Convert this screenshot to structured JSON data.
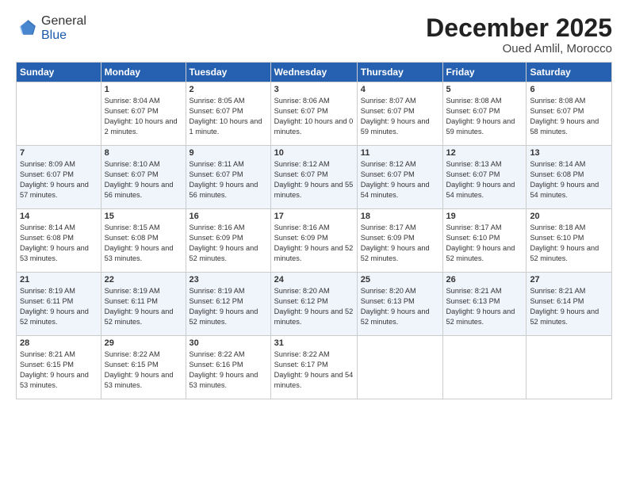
{
  "header": {
    "logo_general": "General",
    "logo_blue": "Blue",
    "month_title": "December 2025",
    "location": "Oued Amlil, Morocco"
  },
  "weekdays": [
    "Sunday",
    "Monday",
    "Tuesday",
    "Wednesday",
    "Thursday",
    "Friday",
    "Saturday"
  ],
  "weeks": [
    [
      {
        "day": "",
        "sunrise": "",
        "sunset": "",
        "daylight": ""
      },
      {
        "day": "1",
        "sunrise": "Sunrise: 8:04 AM",
        "sunset": "Sunset: 6:07 PM",
        "daylight": "Daylight: 10 hours and 2 minutes."
      },
      {
        "day": "2",
        "sunrise": "Sunrise: 8:05 AM",
        "sunset": "Sunset: 6:07 PM",
        "daylight": "Daylight: 10 hours and 1 minute."
      },
      {
        "day": "3",
        "sunrise": "Sunrise: 8:06 AM",
        "sunset": "Sunset: 6:07 PM",
        "daylight": "Daylight: 10 hours and 0 minutes."
      },
      {
        "day": "4",
        "sunrise": "Sunrise: 8:07 AM",
        "sunset": "Sunset: 6:07 PM",
        "daylight": "Daylight: 9 hours and 59 minutes."
      },
      {
        "day": "5",
        "sunrise": "Sunrise: 8:08 AM",
        "sunset": "Sunset: 6:07 PM",
        "daylight": "Daylight: 9 hours and 59 minutes."
      },
      {
        "day": "6",
        "sunrise": "Sunrise: 8:08 AM",
        "sunset": "Sunset: 6:07 PM",
        "daylight": "Daylight: 9 hours and 58 minutes."
      }
    ],
    [
      {
        "day": "7",
        "sunrise": "Sunrise: 8:09 AM",
        "sunset": "Sunset: 6:07 PM",
        "daylight": "Daylight: 9 hours and 57 minutes."
      },
      {
        "day": "8",
        "sunrise": "Sunrise: 8:10 AM",
        "sunset": "Sunset: 6:07 PM",
        "daylight": "Daylight: 9 hours and 56 minutes."
      },
      {
        "day": "9",
        "sunrise": "Sunrise: 8:11 AM",
        "sunset": "Sunset: 6:07 PM",
        "daylight": "Daylight: 9 hours and 56 minutes."
      },
      {
        "day": "10",
        "sunrise": "Sunrise: 8:12 AM",
        "sunset": "Sunset: 6:07 PM",
        "daylight": "Daylight: 9 hours and 55 minutes."
      },
      {
        "day": "11",
        "sunrise": "Sunrise: 8:12 AM",
        "sunset": "Sunset: 6:07 PM",
        "daylight": "Daylight: 9 hours and 54 minutes."
      },
      {
        "day": "12",
        "sunrise": "Sunrise: 8:13 AM",
        "sunset": "Sunset: 6:07 PM",
        "daylight": "Daylight: 9 hours and 54 minutes."
      },
      {
        "day": "13",
        "sunrise": "Sunrise: 8:14 AM",
        "sunset": "Sunset: 6:08 PM",
        "daylight": "Daylight: 9 hours and 54 minutes."
      }
    ],
    [
      {
        "day": "14",
        "sunrise": "Sunrise: 8:14 AM",
        "sunset": "Sunset: 6:08 PM",
        "daylight": "Daylight: 9 hours and 53 minutes."
      },
      {
        "day": "15",
        "sunrise": "Sunrise: 8:15 AM",
        "sunset": "Sunset: 6:08 PM",
        "daylight": "Daylight: 9 hours and 53 minutes."
      },
      {
        "day": "16",
        "sunrise": "Sunrise: 8:16 AM",
        "sunset": "Sunset: 6:09 PM",
        "daylight": "Daylight: 9 hours and 52 minutes."
      },
      {
        "day": "17",
        "sunrise": "Sunrise: 8:16 AM",
        "sunset": "Sunset: 6:09 PM",
        "daylight": "Daylight: 9 hours and 52 minutes."
      },
      {
        "day": "18",
        "sunrise": "Sunrise: 8:17 AM",
        "sunset": "Sunset: 6:09 PM",
        "daylight": "Daylight: 9 hours and 52 minutes."
      },
      {
        "day": "19",
        "sunrise": "Sunrise: 8:17 AM",
        "sunset": "Sunset: 6:10 PM",
        "daylight": "Daylight: 9 hours and 52 minutes."
      },
      {
        "day": "20",
        "sunrise": "Sunrise: 8:18 AM",
        "sunset": "Sunset: 6:10 PM",
        "daylight": "Daylight: 9 hours and 52 minutes."
      }
    ],
    [
      {
        "day": "21",
        "sunrise": "Sunrise: 8:19 AM",
        "sunset": "Sunset: 6:11 PM",
        "daylight": "Daylight: 9 hours and 52 minutes."
      },
      {
        "day": "22",
        "sunrise": "Sunrise: 8:19 AM",
        "sunset": "Sunset: 6:11 PM",
        "daylight": "Daylight: 9 hours and 52 minutes."
      },
      {
        "day": "23",
        "sunrise": "Sunrise: 8:19 AM",
        "sunset": "Sunset: 6:12 PM",
        "daylight": "Daylight: 9 hours and 52 minutes."
      },
      {
        "day": "24",
        "sunrise": "Sunrise: 8:20 AM",
        "sunset": "Sunset: 6:12 PM",
        "daylight": "Daylight: 9 hours and 52 minutes."
      },
      {
        "day": "25",
        "sunrise": "Sunrise: 8:20 AM",
        "sunset": "Sunset: 6:13 PM",
        "daylight": "Daylight: 9 hours and 52 minutes."
      },
      {
        "day": "26",
        "sunrise": "Sunrise: 8:21 AM",
        "sunset": "Sunset: 6:13 PM",
        "daylight": "Daylight: 9 hours and 52 minutes."
      },
      {
        "day": "27",
        "sunrise": "Sunrise: 8:21 AM",
        "sunset": "Sunset: 6:14 PM",
        "daylight": "Daylight: 9 hours and 52 minutes."
      }
    ],
    [
      {
        "day": "28",
        "sunrise": "Sunrise: 8:21 AM",
        "sunset": "Sunset: 6:15 PM",
        "daylight": "Daylight: 9 hours and 53 minutes."
      },
      {
        "day": "29",
        "sunrise": "Sunrise: 8:22 AM",
        "sunset": "Sunset: 6:15 PM",
        "daylight": "Daylight: 9 hours and 53 minutes."
      },
      {
        "day": "30",
        "sunrise": "Sunrise: 8:22 AM",
        "sunset": "Sunset: 6:16 PM",
        "daylight": "Daylight: 9 hours and 53 minutes."
      },
      {
        "day": "31",
        "sunrise": "Sunrise: 8:22 AM",
        "sunset": "Sunset: 6:17 PM",
        "daylight": "Daylight: 9 hours and 54 minutes."
      },
      {
        "day": "",
        "sunrise": "",
        "sunset": "",
        "daylight": ""
      },
      {
        "day": "",
        "sunrise": "",
        "sunset": "",
        "daylight": ""
      },
      {
        "day": "",
        "sunrise": "",
        "sunset": "",
        "daylight": ""
      }
    ]
  ]
}
